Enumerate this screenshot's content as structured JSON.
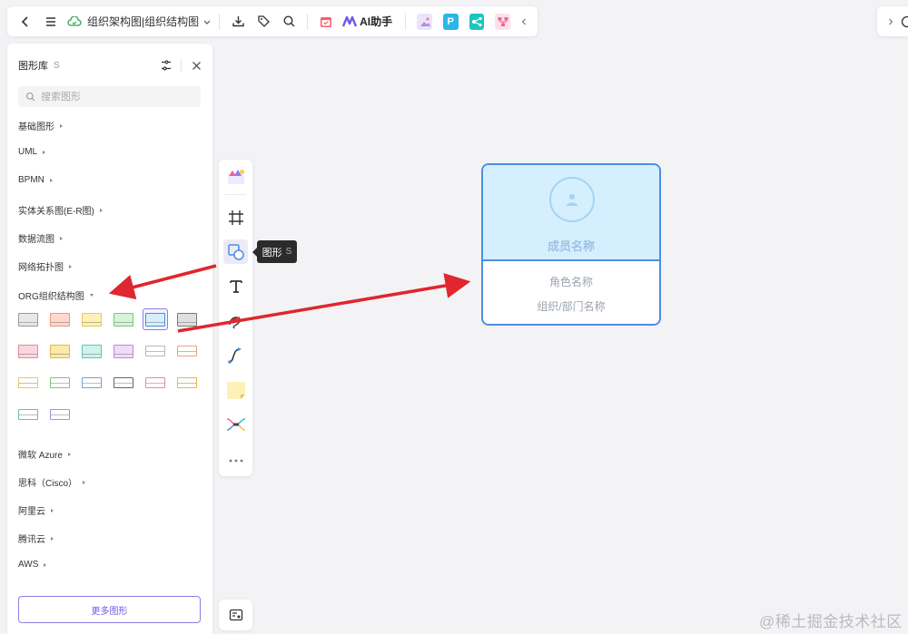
{
  "topbar": {
    "doc_title": "组织架构图|组织结构图",
    "ai_label": "AI助手",
    "plugins": [
      "image-plugin",
      "P",
      "mindmap-plugin",
      "flow-plugin"
    ]
  },
  "library": {
    "title": "图形库",
    "shortcut": "S",
    "search_placeholder": "搜索图形",
    "categories": [
      "基础图形",
      "UML",
      "BPMN",
      "实体关系图(E-R图)",
      "数据流图",
      "网络拓扑图",
      "ORG组织结构图",
      "微软 Azure",
      "思科（Cisco）",
      "阿里云",
      "腾讯云",
      "AWS"
    ],
    "expanded_category": "ORG组织结构图",
    "more_button": "更多图形",
    "org_shapes": [
      {
        "fill": "#e8e8e8",
        "stroke": "#9a9a9a"
      },
      {
        "fill": "#fdd9cc",
        "stroke": "#e89a82"
      },
      {
        "fill": "#fdf1b8",
        "stroke": "#e3c95c"
      },
      {
        "fill": "#d6f4d6",
        "stroke": "#79c979"
      },
      {
        "fill": "#d6efff",
        "stroke": "#4a8fe0"
      },
      {
        "fill": "#e0e0e0",
        "stroke": "#7a7a7a"
      },
      {
        "fill": "#fbd6df",
        "stroke": "#e28aa0"
      },
      {
        "fill": "#fde9a8",
        "stroke": "#e0bb4a"
      },
      {
        "fill": "#cff3ec",
        "stroke": "#5fc4b0"
      },
      {
        "fill": "#efdcfa",
        "stroke": "#b98ad8"
      },
      {
        "fill": "#ffffff",
        "stroke": "#b8b8b8"
      },
      {
        "fill": "#ffffff",
        "stroke": "#e8a28a"
      },
      {
        "fill": "#ffffff",
        "stroke": "#e3c95c"
      },
      {
        "fill": "#ffffff",
        "stroke": "#79c979"
      },
      {
        "fill": "#ffffff",
        "stroke": "#6aa2e0"
      },
      {
        "fill": "#ffffff",
        "stroke": "#666666"
      },
      {
        "fill": "#ffffff",
        "stroke": "#e28aa0"
      },
      {
        "fill": "#ffffff",
        "stroke": "#e0bb4a"
      },
      {
        "fill": "#ffffff",
        "stroke": "#5fc4b0"
      },
      {
        "fill": "#ffffff",
        "stroke": "#b98ad8"
      }
    ],
    "selected_shape": 4
  },
  "vtoolbar": {
    "tools": [
      "template-icon",
      "frame-icon",
      "shape-icon",
      "text-icon",
      "pen-icon",
      "connector-icon",
      "sticky-note-icon",
      "mindmap-icon",
      "more-icon"
    ],
    "active_tool": "shape-icon",
    "tooltip_label": "图形",
    "tooltip_key": "S"
  },
  "card": {
    "name": "成员名称",
    "role": "角色名称",
    "org": "组织/部门名称"
  },
  "colors": {
    "accent": "#6b5ce7",
    "card_border": "#4a8fe0",
    "card_fill": "#d6efff",
    "arrow": "#e0262e"
  },
  "watermark": "@稀土掘金技术社区"
}
